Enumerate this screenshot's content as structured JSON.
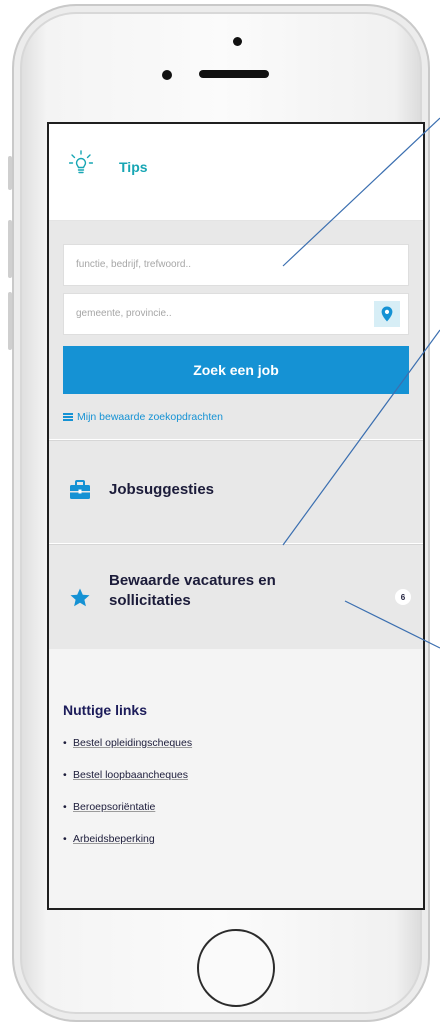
{
  "tips": {
    "label": "Tips"
  },
  "search": {
    "job_placeholder": "functie, bedrijf, trefwoord..",
    "location_placeholder": "gemeente, provincie..",
    "button_label": "Zoek een job",
    "saved_searches_label": "Mijn bewaarde zoekopdrachten"
  },
  "cards": {
    "job_suggestions": {
      "title": "Jobsuggesties"
    },
    "saved": {
      "title_line1": "Bewaarde vacatures en",
      "title_line2": "sollicitaties",
      "count": "6"
    }
  },
  "links": {
    "title": "Nuttige links",
    "items": [
      {
        "label": "Bestel opleidingscheques"
      },
      {
        "label": "Bestel loopbaancheques"
      },
      {
        "label": "Beroepsoriëntatie"
      },
      {
        "label": "Arbeidsbeperking"
      }
    ]
  },
  "colors": {
    "accent": "#1592d4",
    "tips_teal": "#17a6b4",
    "panel_gray": "#e8e8e8",
    "dark_navy": "#1c1c3a"
  },
  "icons": [
    "lightbulb-icon",
    "location-pin-icon",
    "list-icon",
    "briefcase-icon",
    "star-icon"
  ]
}
